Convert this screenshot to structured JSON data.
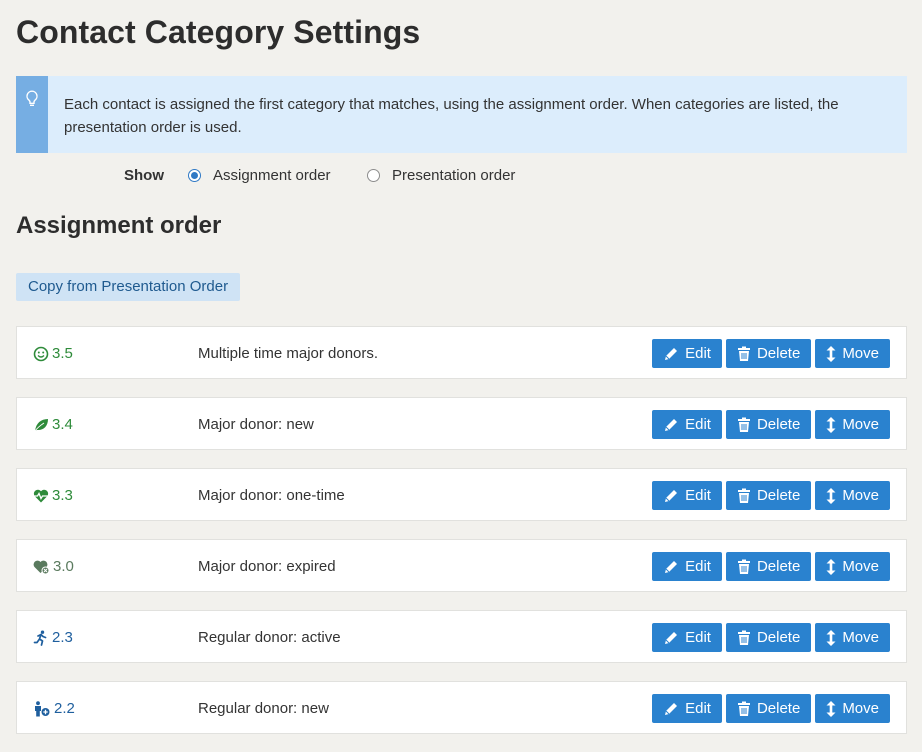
{
  "page": {
    "title": "Contact Category Settings"
  },
  "help": {
    "icon": "lightbulb-icon",
    "text": "Each contact is assigned the first category that matches, using the assignment order. When categories are listed, the presentation order is used."
  },
  "show": {
    "label": "Show",
    "options": [
      {
        "label": "Assignment order",
        "checked": true
      },
      {
        "label": "Presentation order",
        "checked": false
      }
    ]
  },
  "section": {
    "title": "Assignment order"
  },
  "copy_button": {
    "label": "Copy from Presentation Order"
  },
  "actions": {
    "edit": "Edit",
    "delete": "Delete",
    "move": "Move"
  },
  "categories": [
    {
      "code": "3.5",
      "icon": "smile-icon",
      "color": "#2e8b3a",
      "description": "Multiple time major donors."
    },
    {
      "code": "3.4",
      "icon": "leaf-icon",
      "color": "#2e8b3a",
      "description": "Major donor: new"
    },
    {
      "code": "3.3",
      "icon": "heartbeat-icon",
      "color": "#2e8b3a",
      "description": "Major donor: one-time"
    },
    {
      "code": "3.0",
      "icon": "heart-expired-icon",
      "color": "#5a7a5e",
      "description": "Major donor: expired"
    },
    {
      "code": "2.3",
      "icon": "running-person-icon",
      "color": "#1f5f9e",
      "description": "Regular donor: active"
    },
    {
      "code": "2.2",
      "icon": "person-plus-icon",
      "color": "#1f5f9e",
      "description": "Regular donor: new"
    }
  ],
  "colors": {
    "accent": "#2a82cf",
    "help_bg": "#dcedfc",
    "help_bar": "#76aee3"
  }
}
